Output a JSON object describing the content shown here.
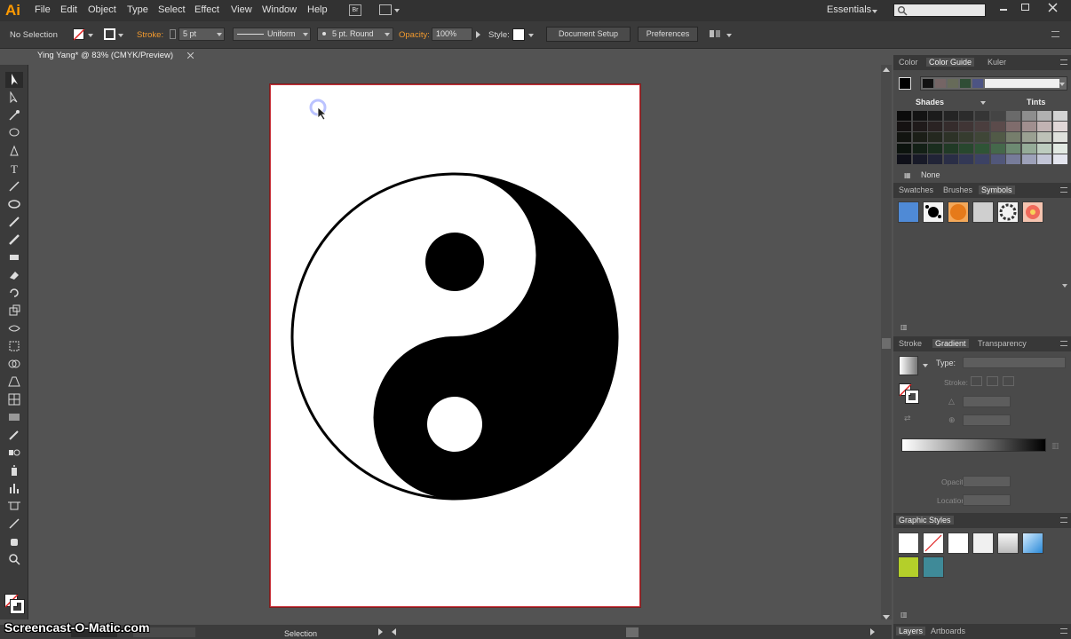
{
  "app": {
    "logo": "Ai"
  },
  "menu": [
    "File",
    "Edit",
    "Object",
    "Type",
    "Select",
    "Effect",
    "View",
    "Window",
    "Help"
  ],
  "bridge_label": "Br",
  "workspace": "Essentials",
  "control_bar": {
    "selection": "No Selection",
    "stroke_label": "Stroke:",
    "stroke_weight": "5 pt",
    "stroke_profile": "Uniform",
    "brush": "5 pt. Round",
    "opacity_label": "Opacity:",
    "opacity_value": "100%",
    "style_label": "Style:",
    "document_setup": "Document Setup",
    "preferences": "Preferences"
  },
  "document_tab": {
    "title": "Ying Yang* @ 83% (CMYK/Preview)"
  },
  "panels": {
    "color_tabs": [
      "Color",
      "Color Guide",
      "Kuler"
    ],
    "shades_label": "Shades",
    "tints_label": "Tints",
    "none_label": "None",
    "symbol_tabs": [
      "Swatches",
      "Brushes",
      "Symbols"
    ],
    "gradient_tabs": [
      "Stroke",
      "Gradient",
      "Transparency"
    ],
    "gradient_type_label": "Type:",
    "gradient_stroke_label": "Stroke:",
    "opacity_label": "Opacity:",
    "location_label": "Location:",
    "graphic_styles_title": "Graphic Styles",
    "bottom_tabs": [
      "Layers",
      "Artboards"
    ]
  },
  "status": {
    "tool": "Selection"
  },
  "watermark": "Screencast-O-Matic.com",
  "colors": {
    "accent": "#ff9a00",
    "artboard_border": "#c8323a"
  }
}
